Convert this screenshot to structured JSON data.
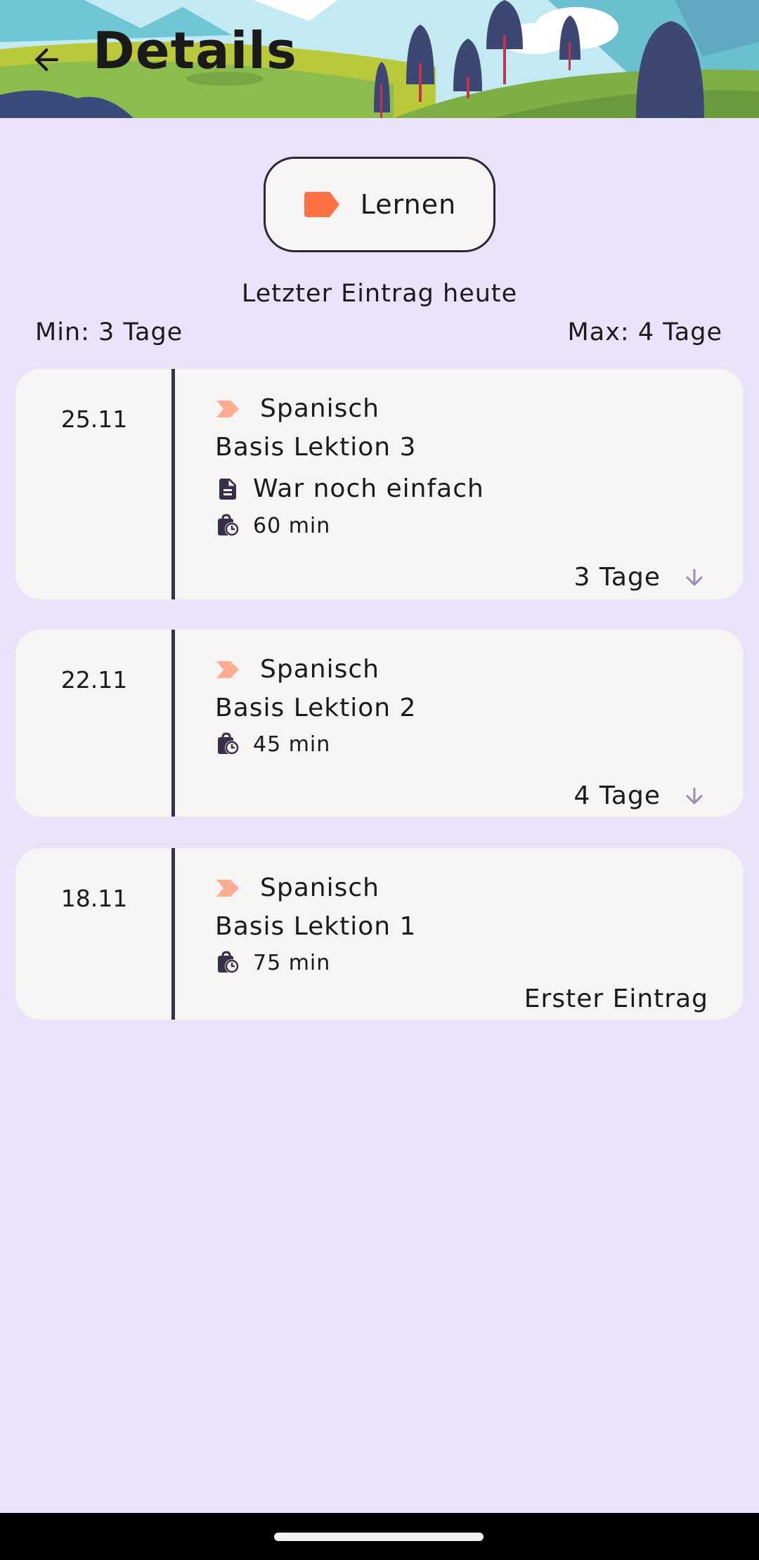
{
  "header": {
    "title": "Details",
    "back_icon": "arrow-left-icon"
  },
  "category": {
    "label": "Lernen",
    "color": "#FF7043",
    "icon": "label-tag-icon"
  },
  "summary": {
    "last_entry": "Letzter Eintrag heute",
    "min": "Min: 3 Tage",
    "max": "Max: 4 Tage"
  },
  "entries": [
    {
      "date": "25.11",
      "subject": "Spanisch",
      "lesson": "Basis Lektion 3",
      "note": "War noch einfach",
      "duration": "60 min",
      "gap": "3 Tage"
    },
    {
      "date": "22.11",
      "subject": "Spanisch",
      "lesson": "Basis Lektion 2",
      "duration": "45 min",
      "gap": "4 Tage"
    },
    {
      "date": "18.11",
      "subject": "Spanisch",
      "lesson": "Basis Lektion 1",
      "duration": "75 min",
      "first_label": "Erster Eintrag"
    }
  ],
  "colors": {
    "background": "#EAE2F8",
    "card": "#F7F5F3",
    "divider": "#3A2E48",
    "subject_accent": "#FFAB91",
    "gap_arrow": "#9A8DB3"
  }
}
